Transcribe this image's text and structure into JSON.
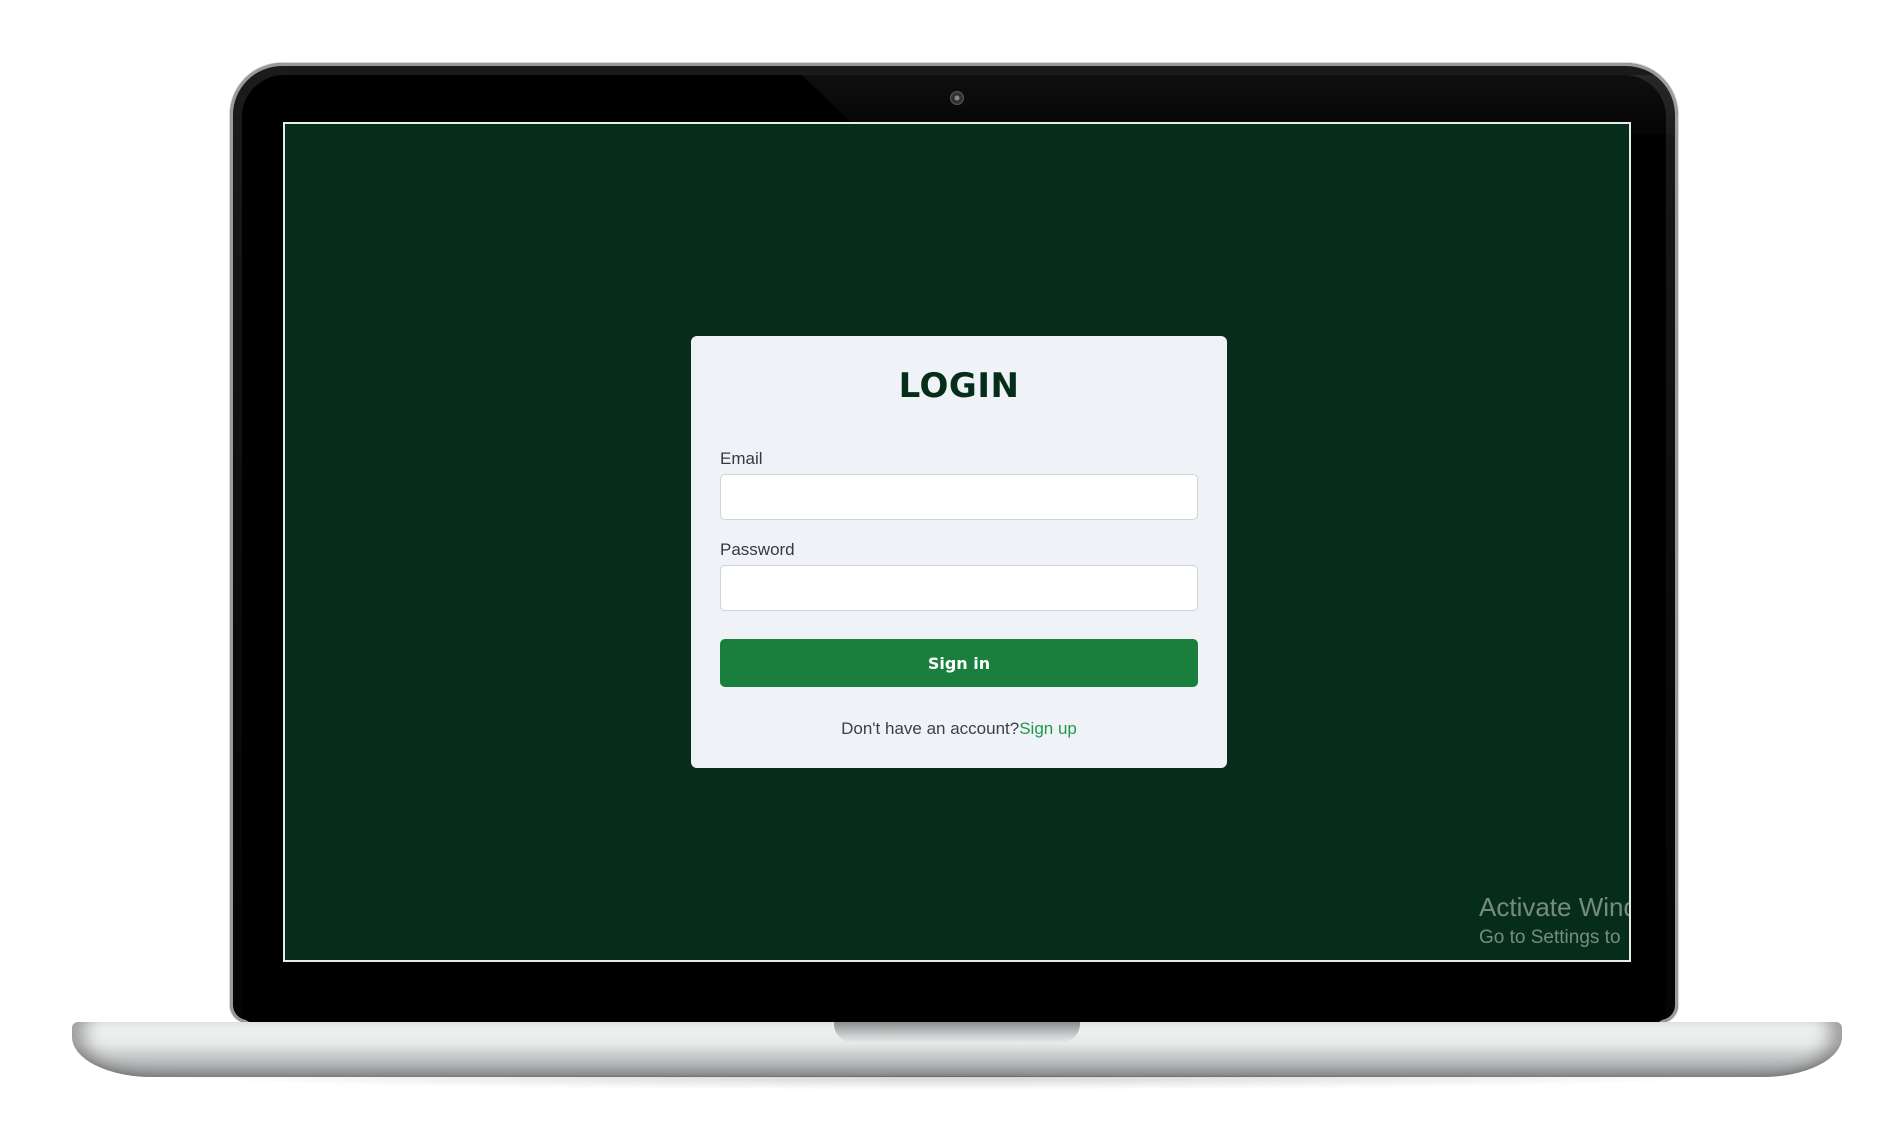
{
  "login": {
    "title": "LOGIN",
    "email_label": "Email",
    "email_value": "",
    "password_label": "Password",
    "password_value": "",
    "signin_label": "Sign in",
    "signup_prompt": "Don't have an account?",
    "signup_link": "Sign up"
  },
  "watermark": {
    "title": "Activate Wind",
    "subtitle": "Go to Settings to"
  },
  "colors": {
    "screen_background": "#052d19",
    "card_background": "#eff3f7",
    "title": "#052d19",
    "button": "#1a7f3d",
    "link": "#1e9a4b"
  }
}
